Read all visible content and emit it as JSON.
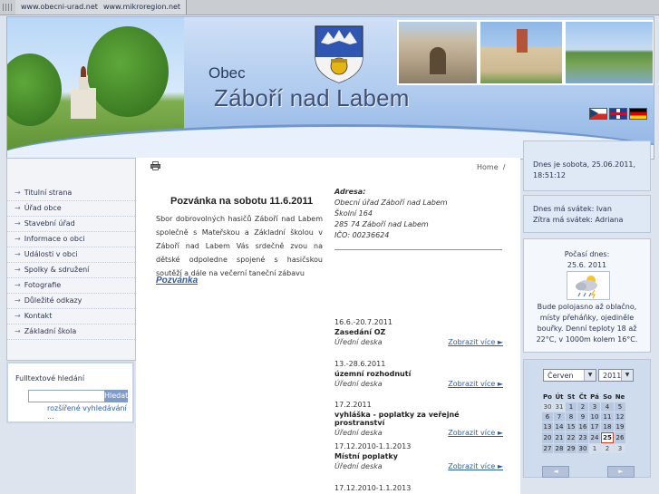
{
  "topbar": {
    "links": [
      "www.obecni-urad.net",
      "www.mikroregion.net"
    ]
  },
  "header": {
    "obec": "Obec",
    "town": "Záboří nad Labem"
  },
  "menu": [
    "Titulní strana",
    "Úřad obce",
    "Stavební úřad",
    "Informace o obci",
    "Události v obci",
    "Spolky & sdružení",
    "Fotografie",
    "Důležité odkazy",
    "Kontakt",
    "Základní škola"
  ],
  "search": {
    "title": "Fulltextové hledání",
    "button": "Hledat",
    "advanced": "rozšířené vyhledávání ..."
  },
  "breadcrumb": {
    "home": "Home",
    "sep": "/"
  },
  "news": {
    "title": "Pozvánka na sobotu 11.6.2011",
    "text": "Sbor dobrovolných hasičů Záboří nad Labem společně s Mateřskou a Základní školou v Záboří nad Labem Vás srdečně zvou na dětské odpoledne spojené s hasičskou soutěží a dále na večerní taneční zábavu",
    "link": "Pozvánka"
  },
  "address": {
    "label": "Adresa:",
    "lines": [
      "Obecní úřad Záboří nad Labem",
      "Školní 164",
      "285 74  Záboří nad Labem",
      "IČO: 00236624"
    ]
  },
  "board": {
    "more": "Zobrazit více ►",
    "items": [
      {
        "date": "16.6.-20.7.2011",
        "title": "Zasedání OZ",
        "cat": "Úřední deska"
      },
      {
        "date": "13.-28.6.2011",
        "title": "územní rozhodnutí",
        "cat": "Úřední deska"
      },
      {
        "date": "17.2.2011",
        "title": "vyhláška - poplatky za veřejné prostranství",
        "cat": "Úřední deska"
      },
      {
        "date": "17.12.2010-1.1.2013",
        "title": "Místní poplatky",
        "cat": "Úřední deska"
      },
      {
        "date": "17.12.2010-1.1.2013",
        "title": "",
        "cat": ""
      }
    ]
  },
  "today": {
    "line1": "Dnes je sobota, 25.06.2011,",
    "line2": "18:51:12"
  },
  "nameday": {
    "today": "Dnes má svátek: Ivan",
    "tomorrow": "Zítra má svátek: Adriana"
  },
  "weather": {
    "title": "Počasí dnes:",
    "date": "25.6. 2011",
    "icon": "cloud-rain-icon",
    "text": "Bude polojasno až oblačno, místy přeháňky, ojediněle bouřky. Denní teploty 18 až 22°C, v 1000m kolem 16°C."
  },
  "calendar": {
    "month": "Červen",
    "year": "2011",
    "days": [
      "Po",
      "Út",
      "St",
      "Čt",
      "Pá",
      "So",
      "Ne"
    ],
    "weeks": [
      [
        "30",
        "31",
        "1",
        "2",
        "3",
        "4",
        "5"
      ],
      [
        "6",
        "7",
        "8",
        "9",
        "10",
        "11",
        "12"
      ],
      [
        "13",
        "14",
        "15",
        "16",
        "17",
        "18",
        "19"
      ],
      [
        "20",
        "21",
        "22",
        "23",
        "24",
        "25",
        "26"
      ],
      [
        "27",
        "28",
        "29",
        "30",
        "1",
        "2",
        "3"
      ]
    ],
    "today": "25",
    "prev": "◄",
    "next": "►"
  },
  "colors": {
    "accent": "#2b5ca6",
    "today_border": "#d43b28"
  }
}
